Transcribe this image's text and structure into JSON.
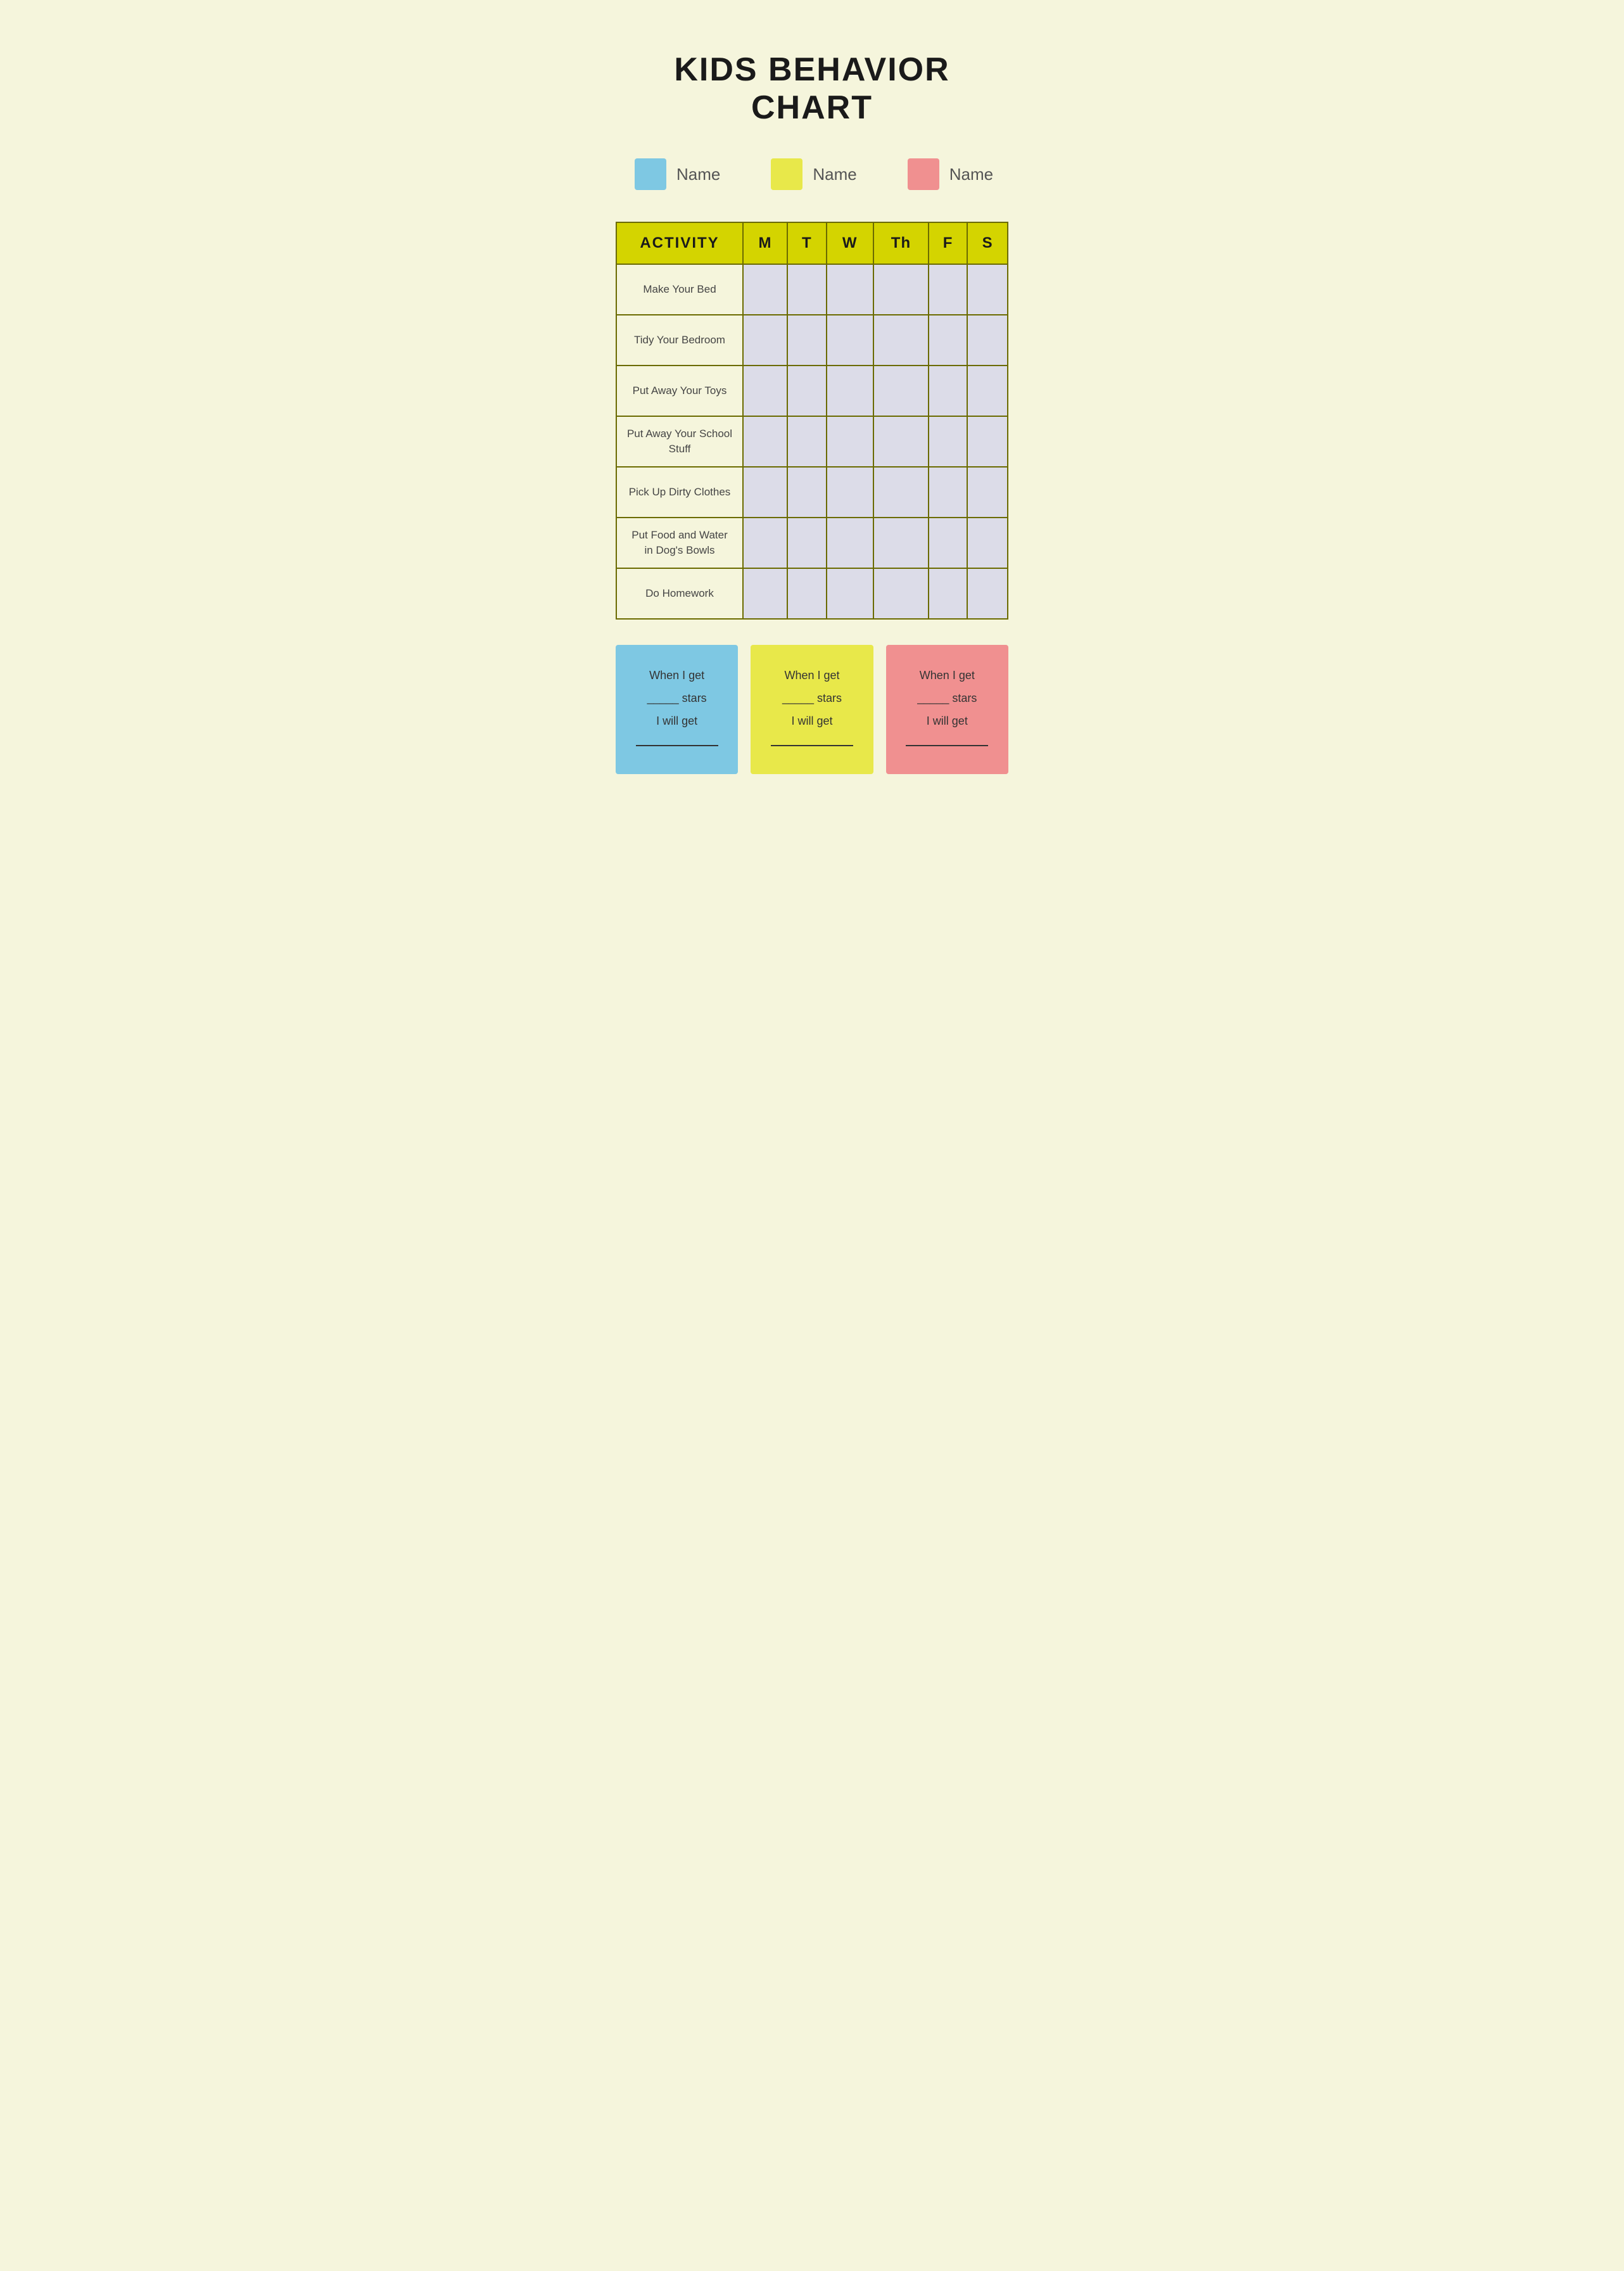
{
  "page": {
    "title": "KIDS BEHAVIOR CHART",
    "background_color": "#f5f5dc",
    "legend": [
      {
        "id": "blue",
        "color": "#7ec8e3",
        "label": "Name"
      },
      {
        "id": "yellow",
        "color": "#e8e84a",
        "label": "Name"
      },
      {
        "id": "pink",
        "color": "#f09090",
        "label": "Name"
      }
    ],
    "table": {
      "headers": [
        "ACTIVITY",
        "M",
        "T",
        "W",
        "Th",
        "F",
        "S"
      ],
      "header_color": "#d4d400",
      "rows": [
        "Make Your Bed",
        "Tidy Your Bedroom",
        "Put Away Your Toys",
        "Put Away Your School Stuff",
        "Pick Up Dirty Clothes",
        "Put Food and Water in Dog's Bowls",
        "Do Homework"
      ]
    },
    "reward_cards": [
      {
        "id": "blue-card",
        "color": "#7ec8e3",
        "line1": "When I get",
        "line2": "_____ stars",
        "line3": "I will get",
        "line4": "_______________"
      },
      {
        "id": "yellow-card",
        "color": "#e8e84a",
        "line1": "When I get",
        "line2": "_____ stars",
        "line3": "I will get",
        "line4": "_______________"
      },
      {
        "id": "pink-card",
        "color": "#f09090",
        "line1": "When I get",
        "line2": "_____ stars",
        "line3": "I will get",
        "line4": "_______________"
      }
    ]
  }
}
